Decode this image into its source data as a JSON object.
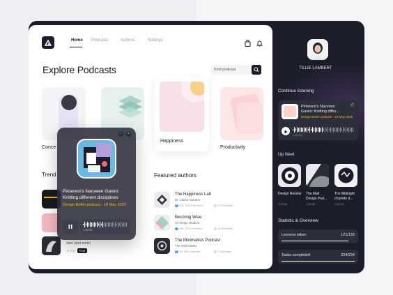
{
  "nav": {
    "items": [
      "Home",
      "Podcasts",
      "Authors",
      "Settings"
    ],
    "active": "Home"
  },
  "page_title": "Explore Podcasts",
  "search": {
    "placeholder": "Find podcast"
  },
  "categories": [
    {
      "label": "Concentration",
      "visible_label": "Conce"
    },
    {
      "label": ""
    },
    {
      "label": "Happiness"
    },
    {
      "label": "Productivity"
    }
  ],
  "trending": {
    "heading": "Trending",
    "visible_heading": "Trend",
    "partial_item": {
      "subtitle": "start (and ends)",
      "rating": "4.3",
      "badge": "Free"
    }
  },
  "player": {
    "title": "Pinterest's Nacveen Gavini: Knitting different disciplines",
    "subtitle": "Design Better podcast - 19 May 2020",
    "time": "1:45:25",
    "progress": 0.45
  },
  "featured": {
    "heading": "Featured authors",
    "authors": [
      {
        "name": "The Happiness Lab",
        "host": "Dr. Laurie Santers",
        "followers": "205, 928 Followers",
        "podcasts": "12 Podcasts"
      },
      {
        "name": "Becomig Wise",
        "host": "On Beign Studios",
        "followers": "156, 213 Learners",
        "podcasts": "10 Podcasts"
      },
      {
        "name": "The Minimalists Podcast",
        "host": "The Minimalists",
        "followers": "78, 345 Learners",
        "podcasts": "7 Podcasts"
      }
    ]
  },
  "profile": {
    "name": "TILLIE LAMBERT"
  },
  "continue": {
    "heading": "Continue listening",
    "title": "Pinterest's Nacveen Gavini: Knitting differ...",
    "subtitle": "Design Better podcast - 19 May 2020",
    "time": "1:45:25",
    "progress": 0.5
  },
  "upnext": {
    "heading": "Up Next",
    "items": [
      {
        "title": "Design Review",
        "duration": "2:25:55"
      },
      {
        "title": "The Mail Design Pod...",
        "duration": "1:45:25"
      },
      {
        "title": "The Midnight charette d...",
        "duration": "1:55:23"
      }
    ]
  },
  "stats": {
    "heading": "Statistic & Overview",
    "items": [
      {
        "label": "Lessons taken",
        "value": "121/133",
        "fraction": 0.91
      },
      {
        "label": "Tasks completed",
        "value": "234/234",
        "fraction": 1.0
      }
    ]
  },
  "colors": {
    "accent": "#f5b324",
    "dark": "#1c1d2a",
    "card_dark": "#2c2e3c"
  }
}
